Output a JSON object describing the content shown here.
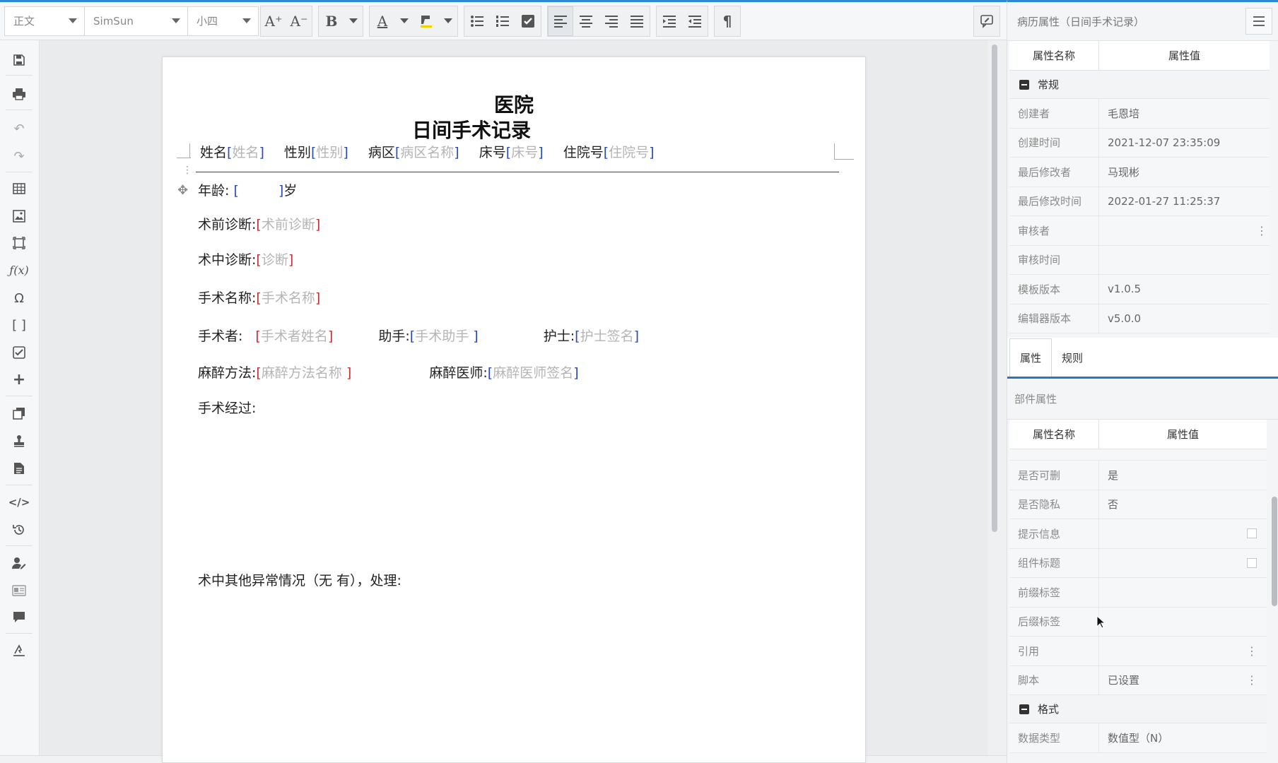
{
  "toolbar": {
    "style_select": "正文",
    "font_select": "SimSun",
    "size_select": "小四",
    "font_grow": "A⁺",
    "font_shrink": "A⁻",
    "bold": "B",
    "font_color": "A",
    "paragraph_mark": "¶"
  },
  "document": {
    "hospital": "医院",
    "title": "日间手术记录",
    "header_fields": [
      {
        "label": "姓名",
        "placeholder": "姓名"
      },
      {
        "label": "性别",
        "placeholder": "性别"
      },
      {
        "label": "病区",
        "placeholder": "病区名称"
      },
      {
        "label": "床号",
        "placeholder": "床号"
      },
      {
        "label": "住院号",
        "placeholder": "住院号"
      }
    ],
    "age_label": "年龄:",
    "age_unit": "岁",
    "preop_label": "术前诊断:",
    "preop_ph": "术前诊断",
    "intraop_label": "术中诊断:",
    "intraop_ph": "诊断",
    "surgery_label": "手术名称:",
    "surgery_ph": "手术名称",
    "surgeon_label": "手术者:",
    "surgeon_ph": "手术者姓名",
    "assistant_label": "助手:",
    "assistant_ph": "手术助手 ",
    "nurse_label": "护士:",
    "nurse_ph": "护士签名",
    "anes_method_label": "麻醉方法:",
    "anes_method_ph": "麻醉方法名称 ",
    "anes_doctor_label": "麻醉医师:",
    "anes_doctor_ph": "麻醉医师签名",
    "process_label": "手术经过:",
    "abnormal_label": "术中其他异常情况（无  有），处理:"
  },
  "panel": {
    "title": "病历属性（日间手术记录）",
    "col_name": "属性名称",
    "col_value": "属性值",
    "general_cat": "常规",
    "general_rows": [
      {
        "k": "创建者",
        "v": "毛恩培"
      },
      {
        "k": "创建时间",
        "v": "2021-12-07 23:35:09"
      },
      {
        "k": "最后修改者",
        "v": "马现彬"
      },
      {
        "k": "最后修改时间",
        "v": "2022-01-27 11:25:37"
      },
      {
        "k": "审核者",
        "v": ""
      },
      {
        "k": "审核时间",
        "v": ""
      },
      {
        "k": "模板版本",
        "v": "v1.0.5"
      },
      {
        "k": "编辑器版本",
        "v": "v5.0.0"
      }
    ],
    "tab_props": "属性",
    "tab_rules": "规则",
    "component_props": "部件属性",
    "comp_rows": [
      {
        "k": "是否可删",
        "v": "是"
      },
      {
        "k": "是否隐私",
        "v": "否"
      },
      {
        "k": "提示信息",
        "v": ""
      },
      {
        "k": "组件标题",
        "v": ""
      },
      {
        "k": "前缀标签",
        "v": ""
      },
      {
        "k": "后缀标签",
        "v": ""
      },
      {
        "k": "引用",
        "v": ""
      },
      {
        "k": "脚本",
        "v": "已设置"
      }
    ],
    "format_cat": "格式",
    "format_rows": [
      {
        "k": "数据类型",
        "v": "数值型（N）"
      }
    ]
  }
}
